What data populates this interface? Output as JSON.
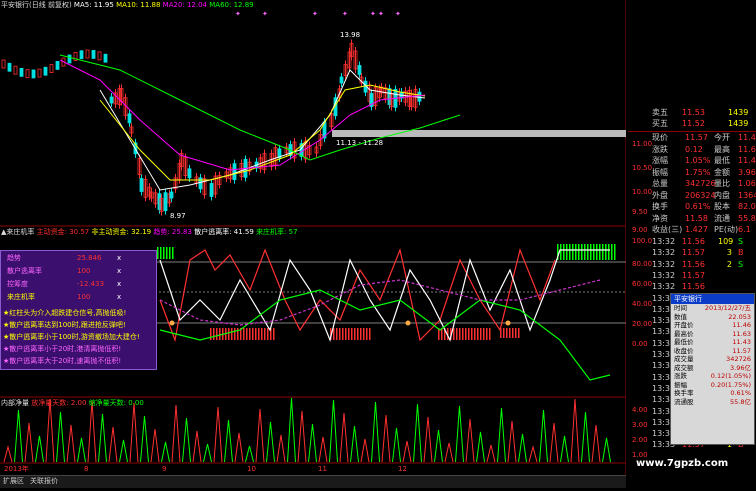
{
  "price_header": {
    "stock": "平安银行(日线 前复权)",
    "ma5": "MA5: 11.95",
    "ma10": "MA10: 11.88",
    "ma20": "MA20: 12.04",
    "ma60": "MA60: 12.89"
  },
  "price_axis": [
    "11.00",
    "10.50",
    "10.00",
    "9.50",
    "9.00"
  ],
  "price_annotations": {
    "high": "13.98",
    "low": "8.97",
    "range_label": "11.13 - 11.28"
  },
  "quote_rows": [
    {
      "label": "卖五",
      "val": "11.53",
      "vol": "1439"
    },
    {
      "label": "买五",
      "val": "11.52",
      "vol": "1439"
    }
  ],
  "quote_stats": [
    {
      "l1": "现价",
      "v1": "11.57",
      "l2": "今开",
      "v2": "11.46"
    },
    {
      "l1": "涨跌",
      "v1": "0.12",
      "l2": "最高",
      "v2": "11.63"
    },
    {
      "l1": "涨幅",
      "v1": "1.05%",
      "l2": "最低",
      "v2": "11.43"
    },
    {
      "l1": "振幅",
      "v1": "1.75%",
      "l2": "金额",
      "v2": "3.96亿"
    },
    {
      "l1": "总量",
      "v1": "342726",
      "l2": "量比",
      "v2": "1.06"
    },
    {
      "l1": "外盘",
      "v1": "206324",
      "l2": "内盘",
      "v2": "136402"
    },
    {
      "l1": "换手",
      "v1": "0.61%",
      "l2": "股本",
      "v2": "82.0亿"
    },
    {
      "l1": "净资",
      "v1": "11.58",
      "l2": "流通",
      "v2": "55.8亿"
    },
    {
      "l1": "收益(三)",
      "v1": "1.427",
      "l2": "PE(动)",
      "v2": "6.1"
    }
  ],
  "ticks": [
    {
      "time": "13:32",
      "price": "11.56",
      "vol": "109",
      "bs": "S"
    },
    {
      "time": "13:32",
      "price": "11.57",
      "vol": "3",
      "bs": "B"
    },
    {
      "time": "13:32",
      "price": "11.56",
      "vol": "2",
      "bs": "S"
    },
    {
      "time": "13:32",
      "price": "11.57",
      "vol": "",
      "bs": ""
    },
    {
      "time": "13:32",
      "price": "11.56",
      "vol": "",
      "bs": ""
    },
    {
      "time": "13:32",
      "price": "",
      "vol": "",
      "bs": ""
    },
    {
      "time": "13:33",
      "price": "",
      "vol": "",
      "bs": ""
    },
    {
      "time": "13:33",
      "price": "",
      "vol": "",
      "bs": ""
    },
    {
      "time": "13:33",
      "price": "",
      "vol": "",
      "bs": ""
    },
    {
      "time": "13:33",
      "price": "",
      "vol": "",
      "bs": ""
    },
    {
      "time": "13:33",
      "price": "",
      "vol": "",
      "bs": ""
    },
    {
      "time": "13:33",
      "price": "",
      "vol": "",
      "bs": ""
    },
    {
      "time": "13:33",
      "price": "",
      "vol": "",
      "bs": ""
    },
    {
      "time": "13:33",
      "price": "",
      "vol": "",
      "bs": ""
    },
    {
      "time": "13:33",
      "price": "",
      "vol": "",
      "bs": ""
    },
    {
      "time": "13:33",
      "price": "",
      "vol": "",
      "bs": ""
    },
    {
      "time": "13:33",
      "price": "",
      "vol": "",
      "bs": ""
    },
    {
      "time": "13:33",
      "price": "11.56",
      "vol": "22",
      "bs": "S"
    },
    {
      "time": "13:33",
      "price": "11.57",
      "vol": "1",
      "bs": "B"
    }
  ],
  "indicator_header": {
    "name": "▲来庄机率",
    "f1": "主动资金: 30.57",
    "f2": "非主动资金: 32.19",
    "f3": "趋势: 25.83",
    "f4": "散户逃离率: 41.59",
    "f5": "来庄机率: 57"
  },
  "indicator_axis": [
    "100.0",
    "80.00",
    "60.00",
    "40.00",
    "20.00",
    "0.00"
  ],
  "popup": {
    "rows": [
      {
        "name": "趋势",
        "value": "25.846"
      },
      {
        "name": "散户逃离率",
        "value": "100"
      },
      {
        "name": "控筹度",
        "value": "-12.433"
      },
      {
        "name": "来庄机率",
        "value": "100"
      }
    ],
    "close_glyph": "x",
    "notes": [
      "★红柱头为介入超跌建仓信号,高抛低吸!",
      "★散户逃离率达到100时,跟进抢反弹吧!",
      "★散户逃离率小于100时,游资撤场加大建仓!",
      "★散户逃离率小于20时,港清离抛低积!",
      "★散户逃离率大于20时,速离抛不低积!"
    ]
  },
  "volume_header": {
    "name": "内部净量",
    "f1": "放净量天数: 2.00",
    "f2": "缩净量天数: 0.00"
  },
  "volume_axis": [
    "4.00",
    "3.00",
    "2.00",
    "1.00"
  ],
  "date_axis": [
    "2013年",
    "8",
    "9",
    "10",
    "11",
    "12"
  ],
  "bottom_bar": {
    "tab1": "扩展区",
    "tab2": "关联报价"
  },
  "watermark": "www.7gpzb.com",
  "tooltip": {
    "title": "平安银行",
    "rows": [
      {
        "k": "时间",
        "v": "2013/12/27/五"
      },
      {
        "k": "数值",
        "v": "22.053"
      },
      {
        "k": "开盘价",
        "v": "11.46"
      },
      {
        "k": "最高价",
        "v": "11.63"
      },
      {
        "k": "最低价",
        "v": "11.43"
      },
      {
        "k": "收盘价",
        "v": "11.57"
      },
      {
        "k": "成交量",
        "v": "342726"
      },
      {
        "k": "成交额",
        "v": "3.96亿"
      },
      {
        "k": "涨跌",
        "v": "0.12(1.05%)"
      },
      {
        "k": "振幅",
        "v": "0.20(1.75%)"
      },
      {
        "k": "换手率",
        "v": "0.61%"
      },
      {
        "k": "流通股",
        "v": "55.8亿"
      }
    ]
  },
  "colors": {
    "up": "#ff3030",
    "down": "#00e0e0",
    "ma5": "#ffffff",
    "ma10": "#ffff00",
    "ma20": "#ff00ff",
    "ma60": "#00ff00",
    "grid": "#8b0000"
  }
}
